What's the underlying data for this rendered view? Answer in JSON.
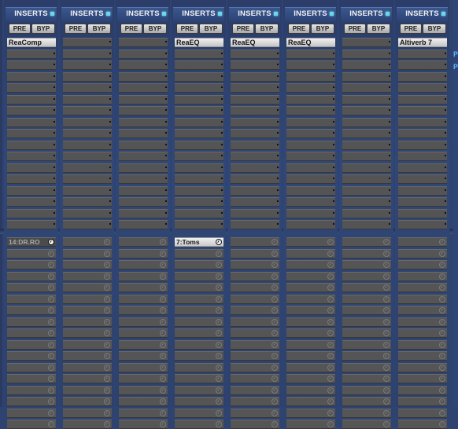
{
  "mixer": {
    "strips": [
      {
        "header": "INSERTS",
        "pre": "PRE",
        "byp": "BYP",
        "inserts": [
          "ReaComp",
          "",
          "",
          "",
          "",
          "",
          "",
          "",
          "",
          "",
          "",
          "",
          "",
          "",
          "",
          "",
          ""
        ],
        "sends": [
          {
            "label": "14:DR.RO­",
            "state": "active"
          },
          {},
          {},
          {},
          {},
          {},
          {},
          {},
          {},
          {},
          {},
          {},
          {},
          {},
          {},
          {},
          {}
        ]
      },
      {
        "header": "INSERTS",
        "pre": "PRE",
        "byp": "BYP",
        "inserts": [
          "",
          "",
          "",
          "",
          "",
          "",
          "",
          "",
          "",
          "",
          "",
          "",
          "",
          "",
          "",
          "",
          ""
        ],
        "sends": [
          {},
          {},
          {},
          {},
          {},
          {},
          {},
          {},
          {},
          {},
          {},
          {},
          {},
          {},
          {},
          {},
          {}
        ]
      },
      {
        "header": "INSERTS",
        "pre": "PRE",
        "byp": "BYP",
        "inserts": [
          "",
          "",
          "",
          "",
          "",
          "",
          "",
          "",
          "",
          "",
          "",
          "",
          "",
          "",
          "",
          "",
          ""
        ],
        "sends": [
          {},
          {},
          {},
          {},
          {},
          {},
          {},
          {},
          {},
          {},
          {},
          {},
          {},
          {},
          {},
          {},
          {}
        ]
      },
      {
        "header": "INSERTS",
        "pre": "PRE",
        "byp": "BYP",
        "inserts": [
          "ReaEQ",
          "",
          "",
          "",
          "",
          "",
          "",
          "",
          "",
          "",
          "",
          "",
          "",
          "",
          "",
          "",
          ""
        ],
        "sends": [
          {
            "label": "7:Toms",
            "state": "filled"
          },
          {},
          {},
          {},
          {},
          {},
          {},
          {},
          {},
          {},
          {},
          {},
          {},
          {},
          {},
          {},
          {}
        ]
      },
      {
        "header": "INSERTS",
        "pre": "PRE",
        "byp": "BYP",
        "inserts": [
          "ReaEQ",
          "",
          "",
          "",
          "",
          "",
          "",
          "",
          "",
          "",
          "",
          "",
          "",
          "",
          "",
          "",
          ""
        ],
        "sends": [
          {},
          {},
          {},
          {},
          {},
          {},
          {},
          {},
          {},
          {},
          {},
          {},
          {},
          {},
          {},
          {},
          {}
        ]
      },
      {
        "header": "INSERTS",
        "pre": "PRE",
        "byp": "BYP",
        "inserts": [
          "ReaEQ",
          "",
          "",
          "",
          "",
          "",
          "",
          "",
          "",
          "",
          "",
          "",
          "",
          "",
          "",
          "",
          ""
        ],
        "sends": [
          {},
          {},
          {},
          {},
          {},
          {},
          {},
          {},
          {},
          {},
          {},
          {},
          {},
          {},
          {},
          {},
          {}
        ]
      },
      {
        "header": "INSERTS",
        "pre": "PRE",
        "byp": "BYP",
        "inserts": [
          "",
          "",
          "",
          "",
          "",
          "",
          "",
          "",
          "",
          "",
          "",
          "",
          "",
          "",
          "",
          "",
          ""
        ],
        "sends": [
          {},
          {},
          {},
          {},
          {},
          {},
          {},
          {},
          {},
          {},
          {},
          {},
          {},
          {},
          {},
          {},
          {}
        ]
      },
      {
        "header": "INSERTS",
        "pre": "PRE",
        "byp": "BYP",
        "inserts": [
          "Altiverb 7",
          "",
          "",
          "",
          "",
          "",
          "",
          "",
          "",
          "",
          "",
          "",
          "",
          "",
          "",
          "",
          ""
        ],
        "sends": [
          {},
          {},
          {},
          {},
          {},
          {},
          {},
          {},
          {},
          {},
          {},
          {},
          {},
          {},
          {},
          {},
          {}
        ]
      }
    ],
    "edge_glyphs": [
      "P",
      "P"
    ]
  },
  "colors": {
    "background": "#2f4370",
    "header_dot": "#69d9ea",
    "slot": "#545454",
    "slot_filled": "#e6e6e6"
  }
}
